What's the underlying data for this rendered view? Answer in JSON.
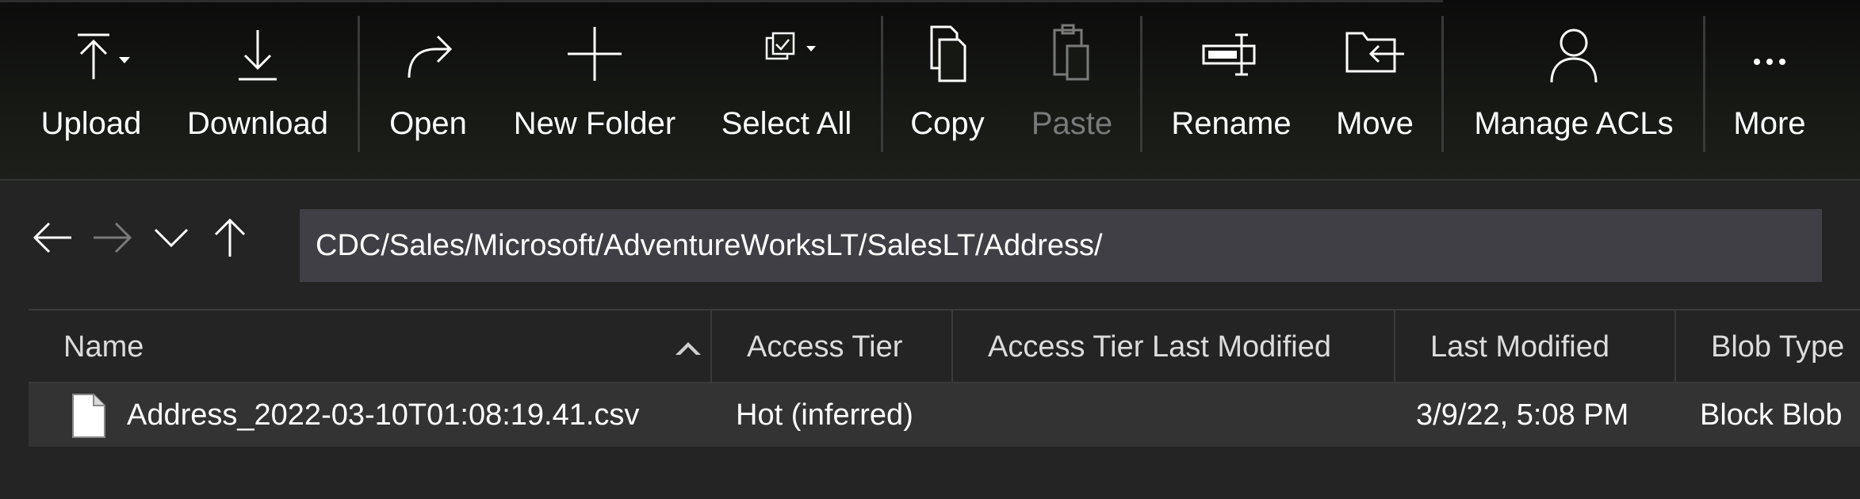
{
  "toolbar": {
    "upload_label": "Upload",
    "download_label": "Download",
    "open_label": "Open",
    "new_folder_label": "New Folder",
    "select_all_label": "Select All",
    "copy_label": "Copy",
    "paste_label": "Paste",
    "rename_label": "Rename",
    "move_label": "Move",
    "manage_acls_label": "Manage ACLs",
    "more_label": "More"
  },
  "navigation": {
    "path": "CDC/Sales/Microsoft/AdventureWorksLT/SalesLT/Address/",
    "back_icon": "arrow-left-icon",
    "forward_icon": "arrow-right-icon",
    "dropdown_icon": "chevron-down-icon",
    "up_icon": "arrow-up-icon"
  },
  "table": {
    "columns": [
      "Name",
      "Access Tier",
      "Access Tier Last Modified",
      "Last Modified",
      "Blob Type"
    ],
    "rows": [
      {
        "name": "Address_2022-03-10T01:08:19.41.csv",
        "access_tier": "Hot (inferred)",
        "access_tier_last_modified": "",
        "last_modified": "3/9/22, 5:08 PM",
        "blob_type": "Block Blob"
      }
    ]
  },
  "colors": {
    "background": "#242424",
    "toolbar": "#161814",
    "path_box": "#3f3f45",
    "selected_row": "#333333",
    "disabled_text": "#7a7a7a"
  }
}
